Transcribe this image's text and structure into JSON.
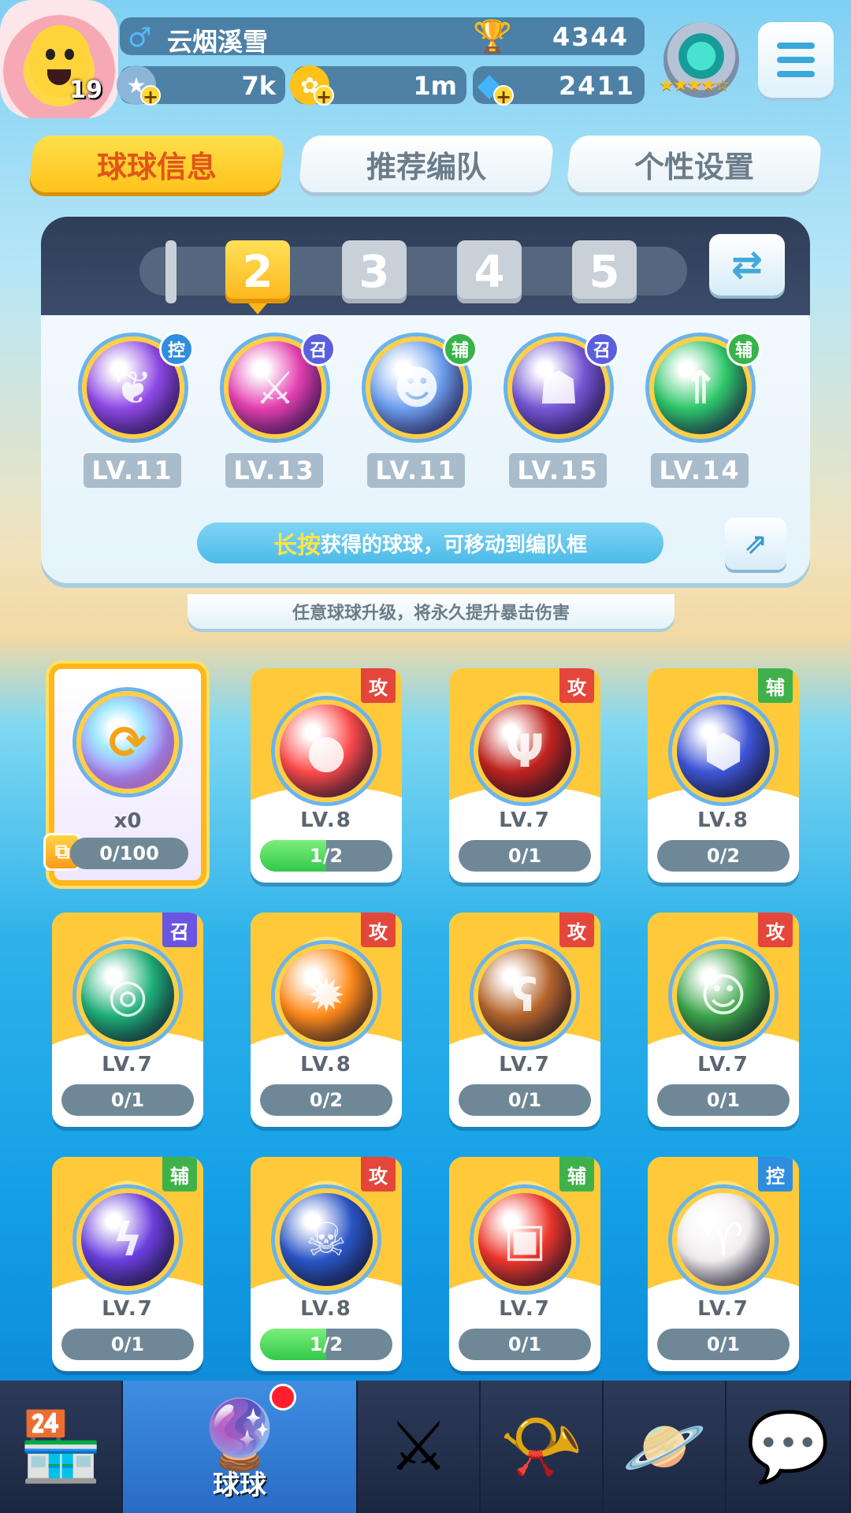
{
  "player": {
    "name": "云烟溪雪",
    "gender_icon": "male-symbol",
    "level": "19",
    "trophies": "4344",
    "stars_currency": "7k",
    "coins": "1m",
    "gems": "2411"
  },
  "tabs": [
    {
      "label": "球球信息",
      "active": true
    },
    {
      "label": "推荐编队",
      "active": false
    },
    {
      "label": "个性设置",
      "active": false
    }
  ],
  "team": {
    "slots": [
      "1",
      "2",
      "3",
      "4",
      "5"
    ],
    "active_slot": "2",
    "balls": [
      {
        "level": "LV.11",
        "type": "控",
        "icon": "butterfly",
        "color": "#8f49e6",
        "badge_color": "#2f8de0"
      },
      {
        "level": "LV.13",
        "type": "召",
        "icon": "blade",
        "color": "#e43fb0",
        "badge_color": "#5a5fe0"
      },
      {
        "level": "LV.11",
        "type": "辅",
        "icon": "crowd",
        "color": "#6ea0ef",
        "badge_color": "#37b34a"
      },
      {
        "level": "LV.15",
        "type": "召",
        "icon": "ghost",
        "color": "#7658d6",
        "badge_color": "#5a5fe0"
      },
      {
        "level": "LV.14",
        "type": "辅",
        "icon": "arrow-star",
        "color": "#2ec86a",
        "badge_color": "#37b34a"
      }
    ],
    "hint_highlight": "长按",
    "hint_text": "获得的球球，可移动到编队框"
  },
  "upgrade_note": "任意球球升级，将永久提升暴击伤害",
  "special_card": {
    "count": "x0",
    "progress": "0/100",
    "progress_fraction": 0
  },
  "collection": [
    {
      "type": "攻",
      "level": "LV.8",
      "progress": "1/2",
      "fill": 0.5,
      "icon": "red-blob",
      "color": "#ff4b4b"
    },
    {
      "type": "攻",
      "level": "LV.7",
      "progress": "0/1",
      "fill": 0,
      "icon": "trident",
      "color": "#c2241f"
    },
    {
      "type": "辅",
      "level": "LV.8",
      "progress": "0/2",
      "fill": 0,
      "icon": "hexagons",
      "color": "#3f56d8"
    },
    {
      "type": "召",
      "level": "LV.7",
      "progress": "0/1",
      "fill": 0,
      "icon": "swirl",
      "color": "#1fb07a"
    },
    {
      "type": "攻",
      "level": "LV.8",
      "progress": "0/2",
      "fill": 0,
      "icon": "flame",
      "color": "#ff8a1a"
    },
    {
      "type": "攻",
      "level": "LV.7",
      "progress": "0/1",
      "fill": 0,
      "icon": "bear",
      "color": "#b5652b"
    },
    {
      "type": "攻",
      "level": "LV.7",
      "progress": "0/1",
      "fill": 0,
      "icon": "man",
      "color": "#3ba54a"
    },
    {
      "type": "辅",
      "level": "LV.7",
      "progress": "0/1",
      "fill": 0,
      "icon": "lightning",
      "color": "#6b3fe0"
    },
    {
      "type": "攻",
      "level": "LV.8",
      "progress": "1/2",
      "fill": 0.5,
      "icon": "opera-mask",
      "color": "#2a56c8"
    },
    {
      "type": "辅",
      "level": "LV.7",
      "progress": "0/1",
      "fill": 0,
      "icon": "red-envelope",
      "color": "#f0362b"
    },
    {
      "type": "控",
      "level": "LV.7",
      "progress": "0/1",
      "fill": 0,
      "icon": "ram-horn",
      "color": "#f3eef0"
    }
  ],
  "type_colors": {
    "攻": "#e5463b",
    "辅": "#3fb14a",
    "召": "#6a55e0",
    "控": "#2f8de0"
  },
  "nav": [
    {
      "icon": "shop-icon",
      "label": ""
    },
    {
      "icon": "balls-icon",
      "label": "球球",
      "active": true,
      "notification": true
    },
    {
      "icon": "crossed-swords-icon",
      "label": ""
    },
    {
      "icon": "whistle-icon",
      "label": ""
    },
    {
      "icon": "planet-icon",
      "label": ""
    },
    {
      "icon": "chat-icon",
      "label": ""
    }
  ]
}
